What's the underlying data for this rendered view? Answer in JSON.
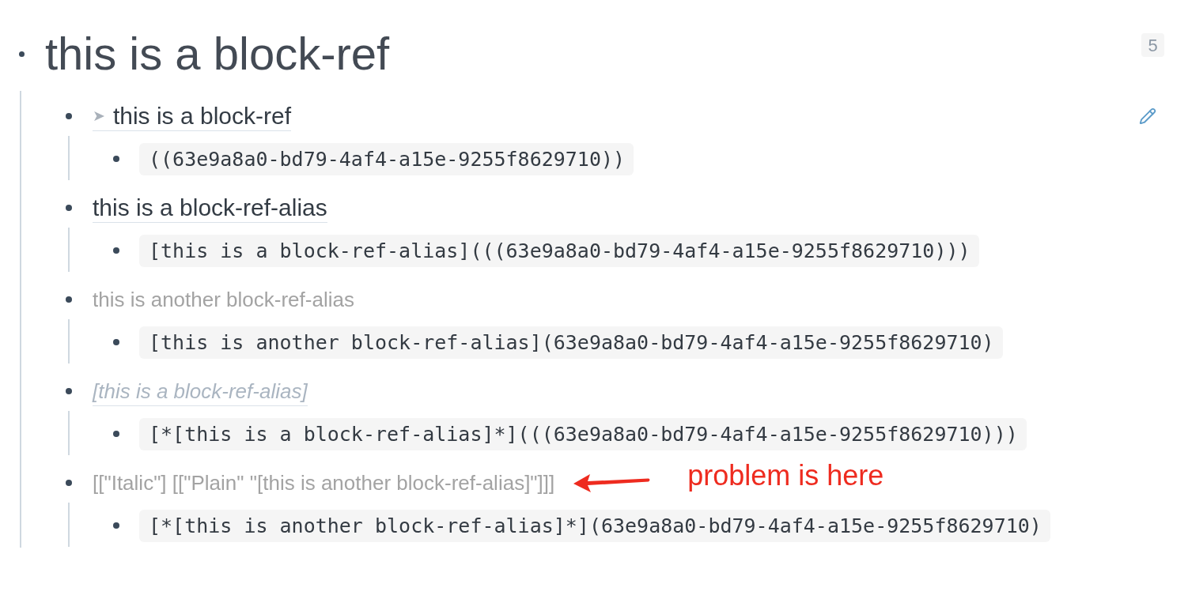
{
  "page": {
    "title": "this is a block-ref",
    "child_count": "5"
  },
  "blocks": [
    {
      "kind": "block-ref",
      "arrow": "➤",
      "text": "this is a block-ref",
      "edit_button": true,
      "children": [
        {
          "code": "((63e9a8a0-bd79-4af4-a15e-9255f8629710))"
        }
      ]
    },
    {
      "kind": "alias-ref",
      "text": "this is a block-ref-alias",
      "edit_button": false,
      "children": [
        {
          "code": "[this is a block-ref-alias](((63e9a8a0-bd79-4af4-a15e-9255f8629710)))"
        }
      ]
    },
    {
      "kind": "raw",
      "text": "this is another block-ref-alias",
      "edit_button": false,
      "children": [
        {
          "code": "[this is another block-ref-alias](63e9a8a0-bd79-4af4-a15e-9255f8629710)"
        }
      ]
    },
    {
      "kind": "italic-ref",
      "text": "[this is a block-ref-alias]",
      "edit_button": false,
      "children": [
        {
          "code": "[*[this is a block-ref-alias]*](((63e9a8a0-bd79-4af4-a15e-9255f8629710)))"
        }
      ]
    },
    {
      "kind": "raw",
      "text": "[[\"Italic\"] [[\"Plain\" \"[this is another block-ref-alias]\"]]]",
      "edit_button": false,
      "annotation": {
        "text": "problem is here"
      },
      "children": [
        {
          "code": "[*[this is another block-ref-alias]*](63e9a8a0-bd79-4af4-a15e-9255f8629710)"
        }
      ]
    }
  ]
}
